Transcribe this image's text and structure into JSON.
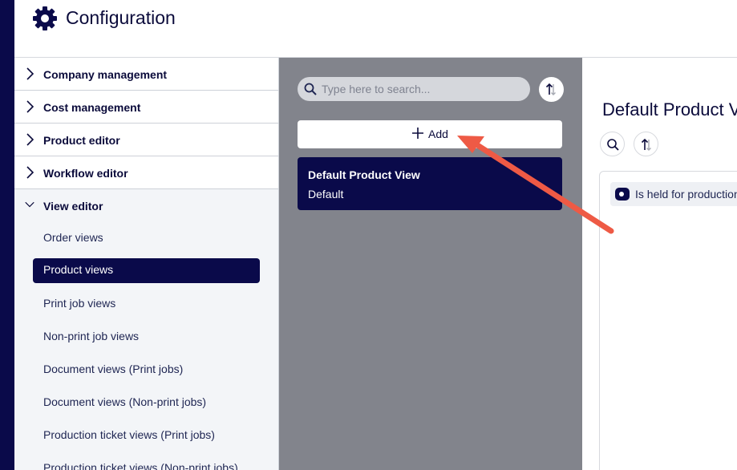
{
  "header": {
    "title": "Configuration",
    "icon": "gear-icon"
  },
  "sidebar": {
    "sections": [
      {
        "label": "Company management",
        "expanded": false
      },
      {
        "label": "Cost management",
        "expanded": false
      },
      {
        "label": "Product editor",
        "expanded": false
      },
      {
        "label": "Workflow editor",
        "expanded": false
      },
      {
        "label": "View editor",
        "expanded": true
      }
    ],
    "view_editor_items": [
      {
        "label": "Order views",
        "active": false
      },
      {
        "label": "Product views",
        "active": true
      },
      {
        "label": "Print job views",
        "active": false
      },
      {
        "label": "Non-print job views",
        "active": false
      },
      {
        "label": "Document views (Print jobs)",
        "active": false
      },
      {
        "label": "Document views (Non-print jobs)",
        "active": false
      },
      {
        "label": "Production ticket views (Print jobs)",
        "active": false
      },
      {
        "label": "Production ticket views (Non-print jobs)",
        "active": false
      }
    ]
  },
  "list_panel": {
    "search_placeholder": "Type here to search...",
    "add_label": "Add",
    "views": [
      {
        "title": "Default Product View",
        "subtitle": "Default"
      }
    ]
  },
  "detail_panel": {
    "title": "Default Product View",
    "fields": [
      {
        "label": "Is held for production"
      }
    ]
  },
  "colors": {
    "brand_navy": "#0a0a4a",
    "panel_gray": "#82848c",
    "annotation_arrow": "#ee5a45"
  }
}
